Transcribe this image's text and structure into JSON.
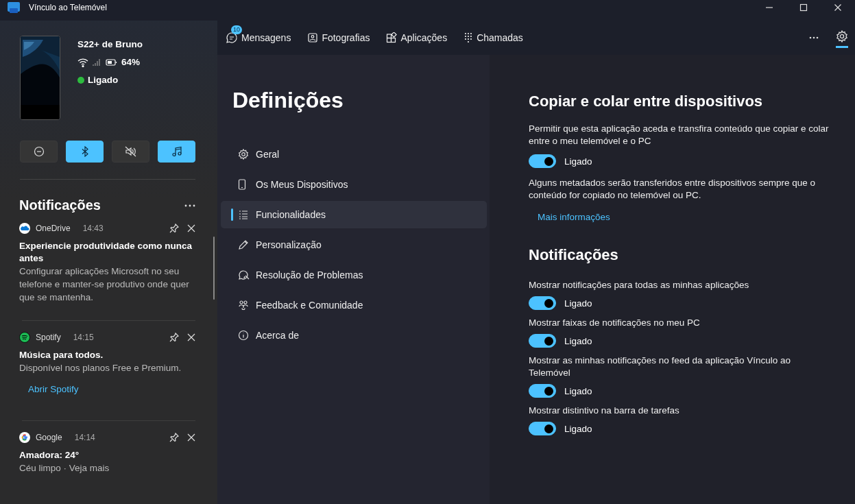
{
  "window": {
    "title": "Vínculo ao Telemóvel"
  },
  "phone": {
    "name": "S22+ de Bruno",
    "battery": "64%",
    "status": "Ligado",
    "connected": true
  },
  "quick_actions": [
    {
      "kind": "dnd",
      "on": false
    },
    {
      "kind": "bluetooth",
      "on": true
    },
    {
      "kind": "mute",
      "on": false
    },
    {
      "kind": "music",
      "on": true
    }
  ],
  "notifications": {
    "title": "Notificações",
    "items": [
      {
        "kind": "onedrive",
        "app": "OneDrive",
        "time": "14:43",
        "title": "Experiencie produtividade como nunca antes",
        "body": "Configurar aplicações Microsoft no seu telefone e manter-se produtivo onde quer que se mantenha."
      },
      {
        "kind": "spotify",
        "app": "Spotify",
        "time": "14:15",
        "title": "Música para todos.",
        "body": "Disponível nos planos Free e Premium.",
        "action": "Abrir Spotify"
      },
      {
        "kind": "google",
        "app": "Google",
        "time": "14:14",
        "title": "Amadora: 24°",
        "body": "Céu limpo · Veja mais"
      }
    ]
  },
  "nav": {
    "tabs": [
      {
        "kind": "messages",
        "label": "Mensagens",
        "badge": "10",
        "selected": false
      },
      {
        "kind": "photos",
        "label": "Fotografias",
        "selected": false
      },
      {
        "kind": "apps",
        "label": "Aplicações",
        "selected": false
      },
      {
        "kind": "calls",
        "label": "Chamadas",
        "selected": false
      }
    ],
    "settings_selected": true
  },
  "settings": {
    "title": "Definições",
    "menu": [
      {
        "kind": "general",
        "label": "Geral",
        "selected": false
      },
      {
        "kind": "devices",
        "label": "Os Meus Dispositivos",
        "selected": false
      },
      {
        "kind": "features",
        "label": "Funcionalidades",
        "selected": true
      },
      {
        "kind": "personalize",
        "label": "Personalização",
        "selected": false
      },
      {
        "kind": "troubleshoot",
        "label": "Resolução de Problemas",
        "selected": false
      },
      {
        "kind": "feedback",
        "label": "Feedback e Comunidade",
        "selected": false
      },
      {
        "kind": "about",
        "label": "Acerca de",
        "selected": false
      }
    ]
  },
  "sections": [
    {
      "heading": "Copiar e colar entre dispositivos",
      "items": [
        {
          "kind": "text",
          "text": "Permitir que esta aplicação aceda e transfira conteúdo que copiar e colar entre o meu telemóvel e o PC"
        },
        {
          "kind": "toggle",
          "on": true,
          "state": "Ligado"
        },
        {
          "kind": "note",
          "text": "Alguns metadados serão transferidos entre dispositivos sempre que o conteúdo for copiado no telemóvel ou PC."
        },
        {
          "kind": "link",
          "text": "Mais informações"
        }
      ]
    },
    {
      "heading": "Notificações",
      "items": [
        {
          "kind": "text",
          "text": "Mostrar notificações para todas as minhas aplicações"
        },
        {
          "kind": "toggle",
          "on": true,
          "state": "Ligado"
        },
        {
          "kind": "text",
          "text": "Mostrar faixas de notificações no meu PC"
        },
        {
          "kind": "toggle",
          "on": true,
          "state": "Ligado"
        },
        {
          "kind": "text",
          "text": "Mostrar as minhas notificações no feed da aplicação Vínculo ao Telemóvel"
        },
        {
          "kind": "toggle",
          "on": true,
          "state": "Ligado"
        },
        {
          "kind": "text",
          "text": "Mostrar distintivo na barra de tarefas"
        },
        {
          "kind": "toggle",
          "on": true,
          "state": "Ligado"
        }
      ]
    }
  ]
}
